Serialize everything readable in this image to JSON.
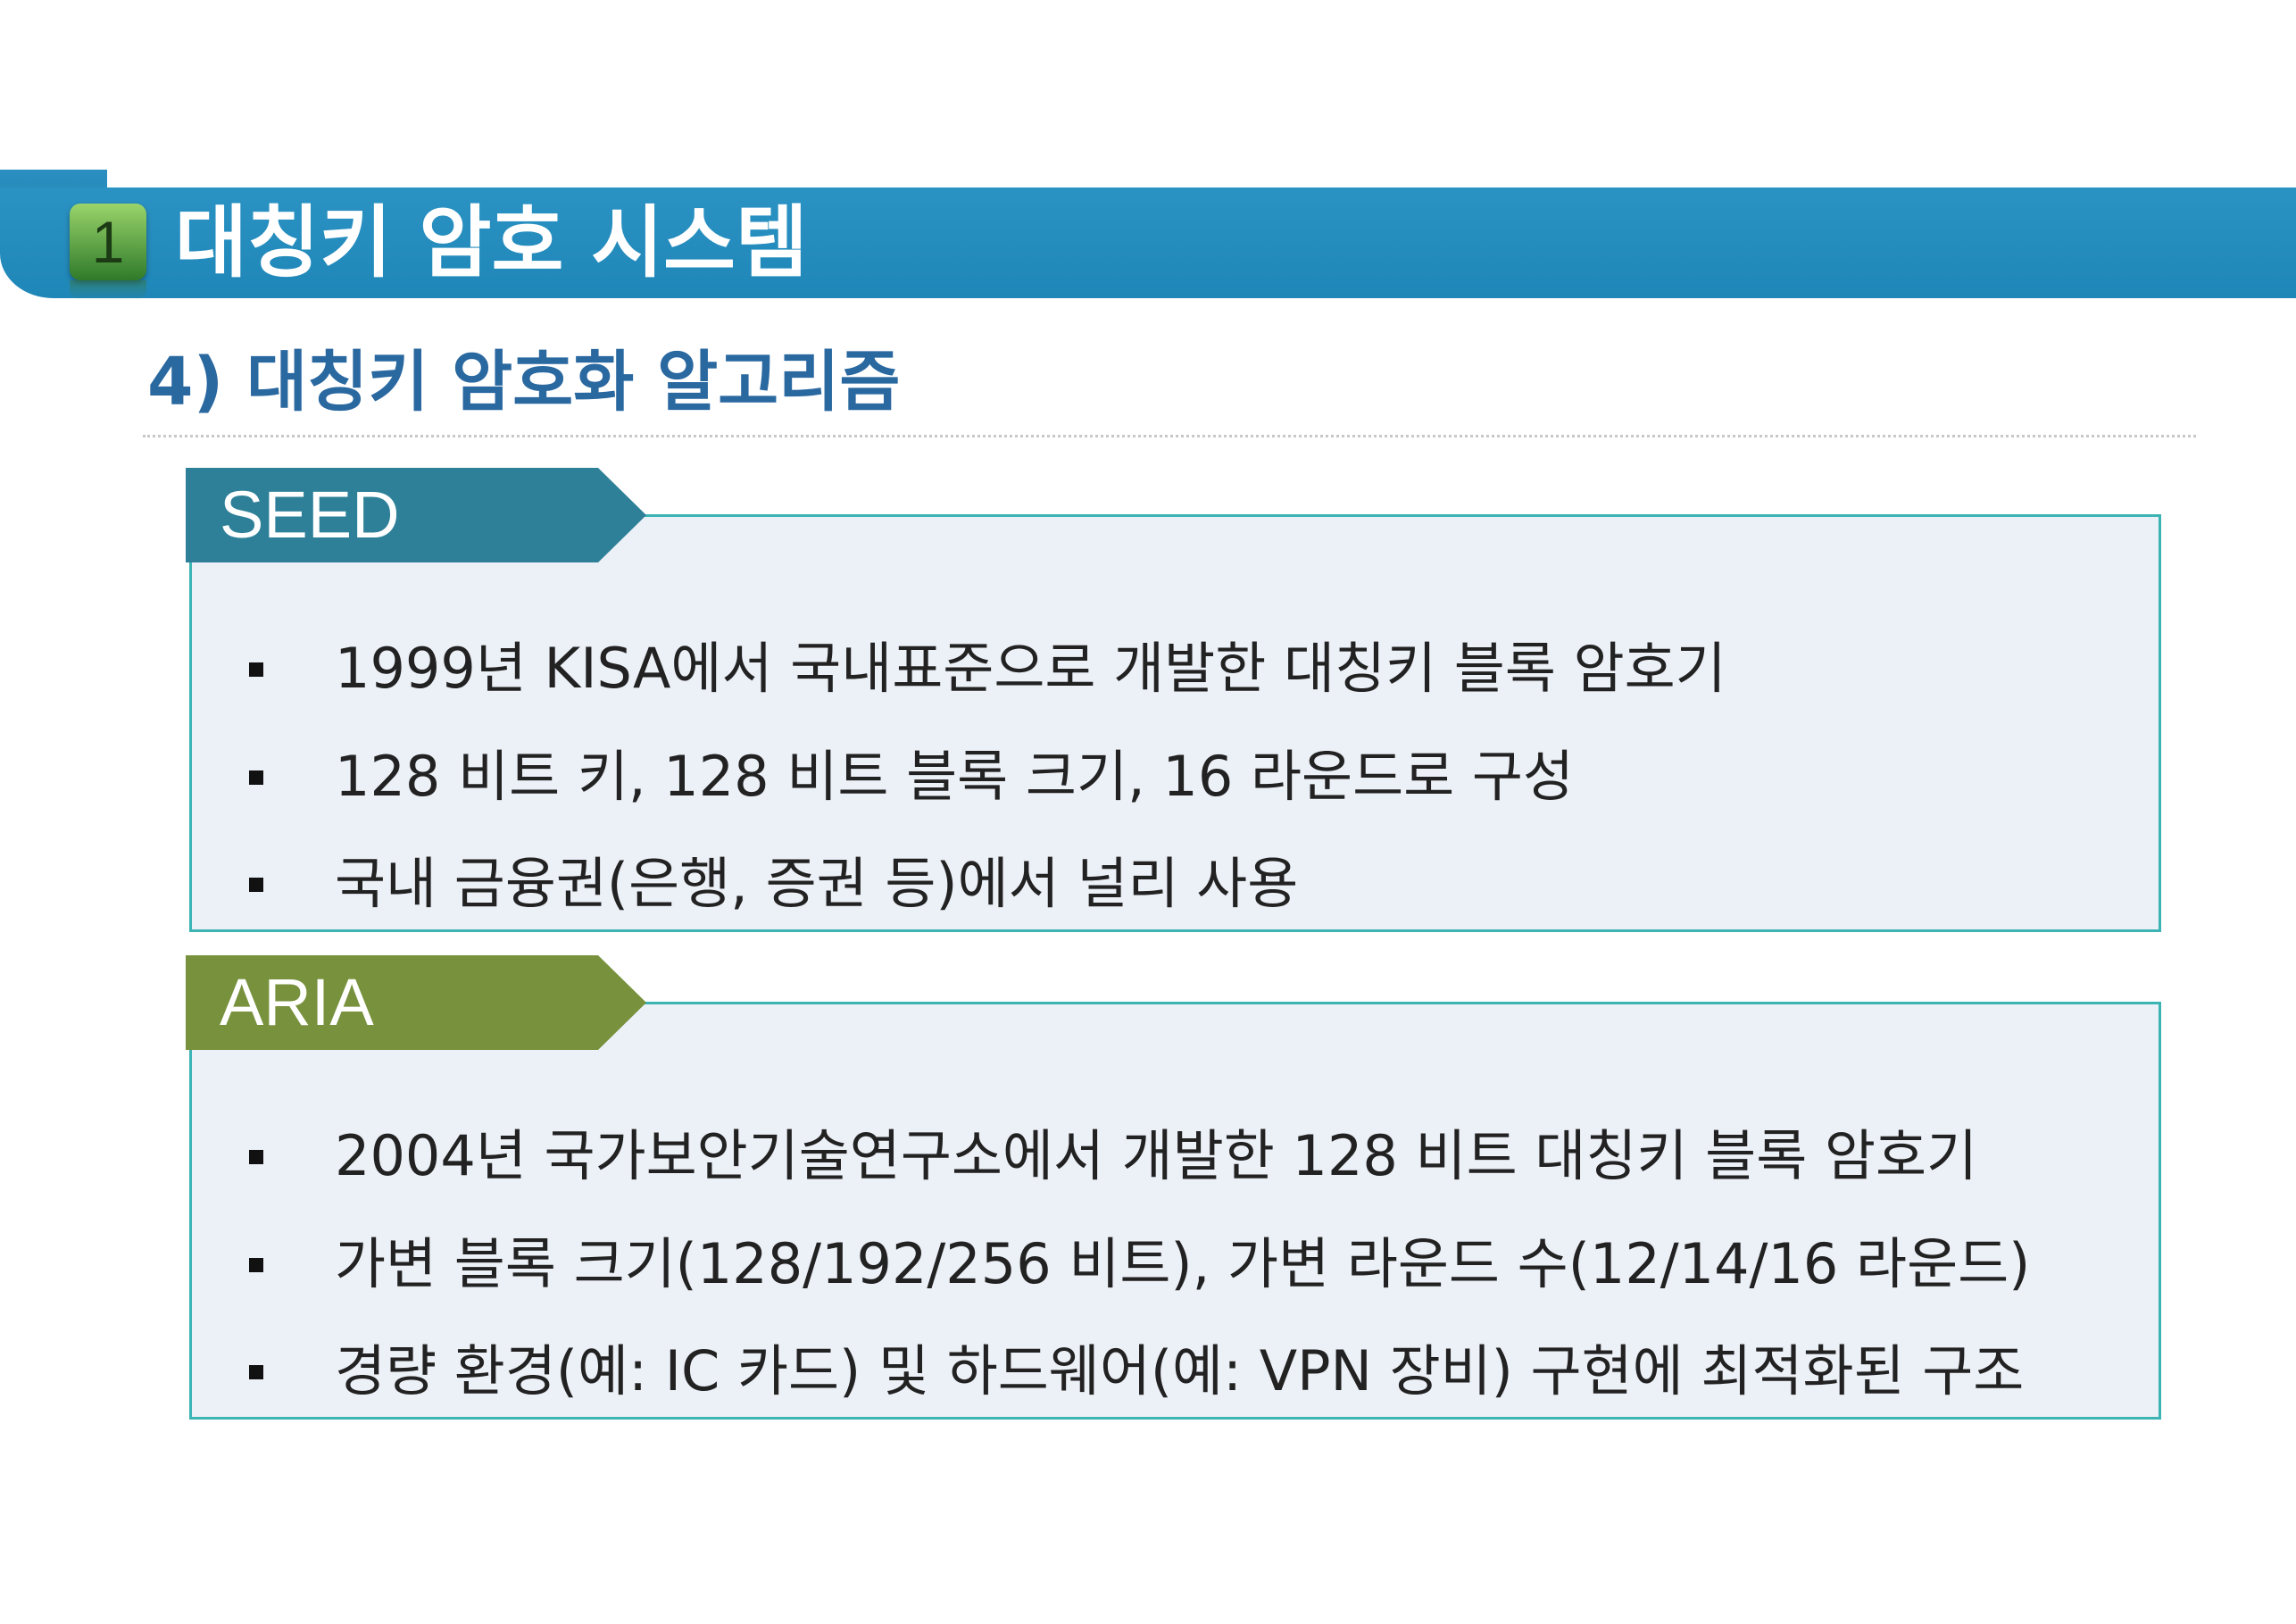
{
  "header": {
    "section_number": "1",
    "title": "대칭키 암호 시스템"
  },
  "subheading": "4) 대칭키 암호화 알고리즘",
  "sections": [
    {
      "label": "SEED",
      "color": "#2e8098",
      "bullets": [
        "1999년 KISA에서 국내표준으로 개발한 대칭키 블록 암호기",
        "128 비트 키, 128 비트 블록 크기, 16 라운드로 구성",
        "국내 금융권(은행, 증권 등)에서 널리 사용"
      ]
    },
    {
      "label": "ARIA",
      "color": "#77913c",
      "bullets": [
        "2004년 국가보안기술연구소에서 개발한 128 비트 대칭키 블록 암호기",
        "가변 블록 크기(128/192/256 비트), 가변 라운드 수(12/14/16 라운드)",
        "경량 환경(예: IC 카드) 및 하드웨어(예: VPN 장비) 구현에 최적화된 구조"
      ]
    }
  ]
}
